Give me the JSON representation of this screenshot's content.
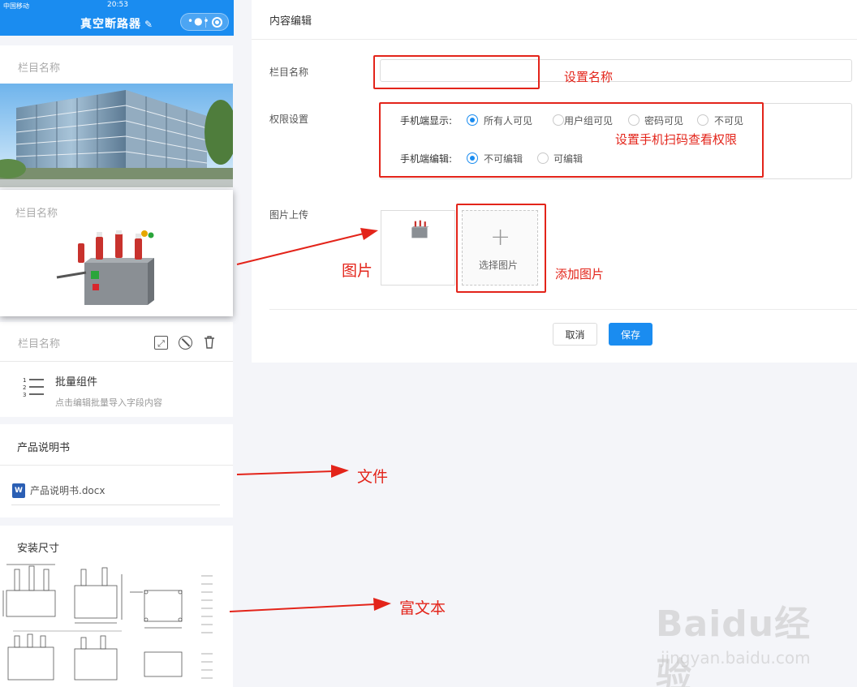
{
  "phone": {
    "status_left": "中国移动",
    "status_time": "20:53",
    "title": "真空断路器",
    "edit_icon": "pencil-icon",
    "capsule": {
      "more_icon": "more-dots-icon",
      "close_icon": "target-circle-icon"
    }
  },
  "cards": {
    "building_label": "栏目名称",
    "breaker_label": "栏目名称",
    "batch": {
      "label": "栏目名称",
      "title": "批量组件",
      "desc": "点击编辑批量导入字段内容",
      "tool_icons": [
        "expand-icon",
        "ban-icon",
        "trash-icon"
      ]
    },
    "manual": {
      "title": "产品说明书",
      "file": "产品说明书.docx"
    },
    "install": {
      "title": "安装尺寸"
    }
  },
  "editor": {
    "title": "内容编辑",
    "name_label": "栏目名称",
    "name_value": "",
    "permission_label": "权限设置",
    "mobile_display": {
      "label": "手机端显示:",
      "options": [
        "所有人可见",
        "用户组可见",
        "密码可见",
        "不可见"
      ],
      "selected": "所有人可见"
    },
    "mobile_edit": {
      "label": "手机端编辑:",
      "options": [
        "不可编辑",
        "可编辑"
      ],
      "selected": "不可编辑"
    },
    "upload_label": "图片上传",
    "add_image": "选择图片",
    "cancel": "取消",
    "save": "保存"
  },
  "annotations": {
    "set_name": "设置名称",
    "set_permission": "设置手机扫码查看权限",
    "picture": "图片",
    "add_picture": "添加图片",
    "file": "文件",
    "rich_text": "富文本",
    "color": "#e3241a"
  },
  "watermark": {
    "main": "Baidu经验",
    "sub": "jingyan.baidu.com"
  },
  "colors": {
    "primary": "#1a8cf0",
    "annotation": "#e3241a"
  }
}
